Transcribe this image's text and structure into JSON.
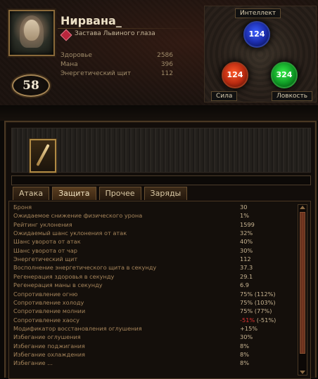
{
  "character": {
    "name": "Нирвана_",
    "guild": "Застава Львиного глаза",
    "level": "58",
    "resources": [
      {
        "label": "Здоровье",
        "value": "2586"
      },
      {
        "label": "Мана",
        "value": "396"
      },
      {
        "label": "Энергетический щит",
        "value": "112"
      }
    ]
  },
  "attributes": {
    "intelligence": {
      "label": "Интеллект",
      "value": "124",
      "color": "#2c44d8"
    },
    "strength": {
      "label": "Сила",
      "value": "124",
      "color": "#c8381a"
    },
    "dexterity": {
      "label": "Ловкость",
      "value": "324",
      "color": "#1ea832"
    }
  },
  "weapon": {
    "progress_percent": 0
  },
  "tabs": [
    {
      "label": "Атака",
      "active": false
    },
    {
      "label": "Защита",
      "active": true
    },
    {
      "label": "Прочее",
      "active": false
    },
    {
      "label": "Заряды",
      "active": false
    }
  ],
  "stats": [
    {
      "label": "Броня",
      "value": "30"
    },
    {
      "label": "Ожидаемое снижение физического урона",
      "value": "1%"
    },
    {
      "label": "Рейтинг уклонения",
      "value": "1599"
    },
    {
      "label": "Ожидаемый шанс уклонения от атак",
      "value": "32%"
    },
    {
      "label": "Шанс уворота от атак",
      "value": "40%"
    },
    {
      "label": "Шанс уворота от чар",
      "value": "30%"
    },
    {
      "label": "Энергетический щит",
      "value": "112"
    },
    {
      "label": "Восполнение энергетического щита в секунду",
      "value": "37.3"
    },
    {
      "label": "Регенерация здоровья в секунду",
      "value": "29.1"
    },
    {
      "label": "Регенерация маны в секунду",
      "value": "6.9"
    },
    {
      "label": "Сопротивление огню",
      "value": "75% (112%)"
    },
    {
      "label": "Сопротивление холоду",
      "value": "75% (103%)"
    },
    {
      "label": "Сопротивление молнии",
      "value": "75% (77%)"
    },
    {
      "label": "Сопротивление хаосу",
      "value_neg": "-51%",
      "value_rest": " (-51%)"
    },
    {
      "label": "Модификатор восстановления оглушения",
      "value": "+15%"
    },
    {
      "label": "Избегание оглушения",
      "value": "30%"
    },
    {
      "label": "Избегание поджигания",
      "value": "8%"
    },
    {
      "label": "Избегание охлаждения",
      "value": "8%"
    },
    {
      "label": "Избегание ...",
      "value": "8%"
    }
  ]
}
